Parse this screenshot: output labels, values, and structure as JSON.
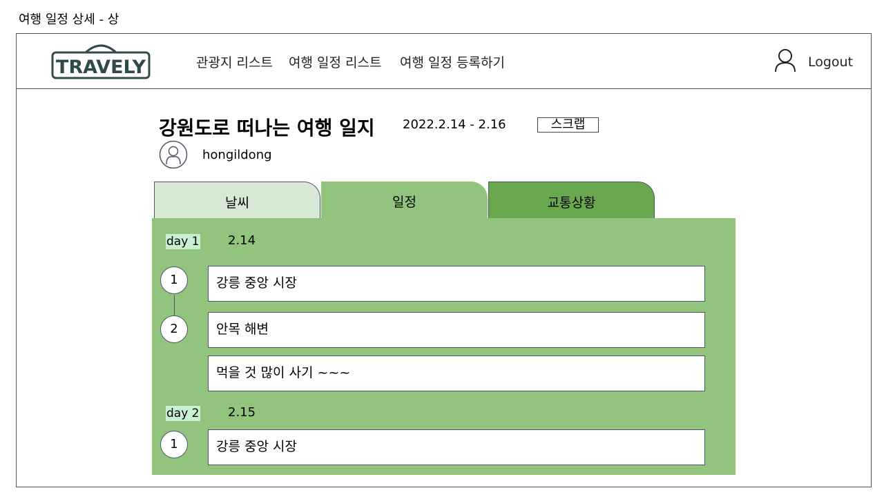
{
  "page_caption": "여행 일정 상세 - 상",
  "header": {
    "logo_text": "TRAVELY",
    "nav": [
      "관광지 리스트",
      "여행 일정 리스트",
      "여행 일정 등록하기"
    ],
    "logout_label": "Logout"
  },
  "trip": {
    "title": "강원도로 떠나는 여행 일지",
    "dates": "2022.2.14 - 2.16",
    "scrap_label": "스크랩",
    "author": "hongildong"
  },
  "tabs": [
    "날씨",
    "일정",
    "교통상황"
  ],
  "active_tab": "일정",
  "days": [
    {
      "label": "day 1",
      "date": "2.14",
      "stops": [
        {
          "number": "1",
          "place": "강릉 중앙 시장"
        },
        {
          "number": "2",
          "place": "안목 해변"
        }
      ],
      "note": "먹을 것 많이 사기 ~~~"
    },
    {
      "label": "day 2",
      "date": "2.15",
      "stops": [
        {
          "number": "1",
          "place": "강릉 중앙 시장"
        }
      ]
    }
  ],
  "colors": {
    "tab_weather": "#d8ead6",
    "tab_schedule": "#93c47d",
    "tab_traffic": "#6aa84f",
    "day_label_bg": "#c8f0d2",
    "logo": "#2f4a4a"
  }
}
